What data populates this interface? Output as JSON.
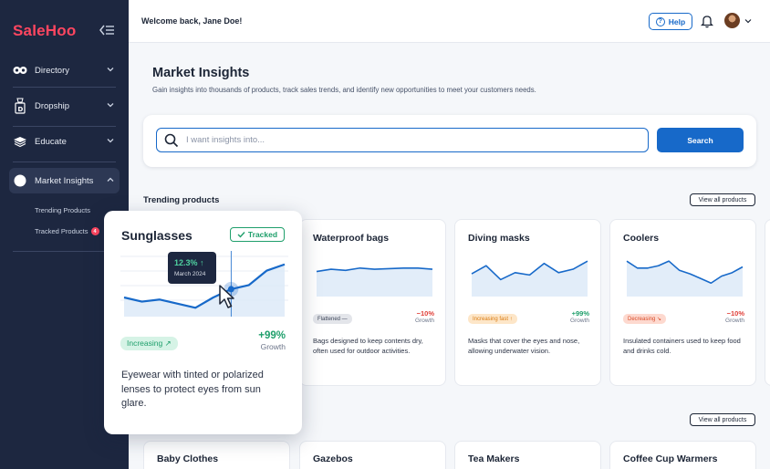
{
  "brand": {
    "logo": "SaleHoo",
    "accent": "#ff4660",
    "primary": "#1769c9"
  },
  "sidebar": {
    "items": [
      {
        "label": "Directory",
        "icon": "directory-icon"
      },
      {
        "label": "Dropship",
        "icon": "dropship-icon"
      },
      {
        "label": "Educate",
        "icon": "educate-icon"
      },
      {
        "label": "Market Insights",
        "icon": "market-insights-icon",
        "active": true
      }
    ],
    "sub_items": [
      {
        "label": "Trending Products"
      },
      {
        "label": "Tracked Products",
        "badge": "4"
      }
    ]
  },
  "header": {
    "welcome": "Welcome back, Jane Doe!",
    "help": "Help"
  },
  "page": {
    "title": "Market Insights",
    "subtitle": "Gain insights into thousands of products, track sales trends, and identify new opportunities to meet your customers needs."
  },
  "search": {
    "placeholder": "I want insights into...",
    "button": "Search"
  },
  "trending": {
    "title": "Trending products",
    "view_all": "View all products",
    "cards": [
      {
        "title": "Waterproof bags",
        "badge": "Flattened —",
        "badge_type": "flat",
        "growth": "−10%",
        "growth_label": "Growth",
        "desc": "Bags designed to keep contents dry, often used for outdoor activities.",
        "spark": [
          62,
          66,
          64,
          68,
          66,
          67,
          68,
          68,
          66
        ]
      },
      {
        "title": "Diving masks",
        "badge": "Increasing fast ↑",
        "badge_type": "inc",
        "growth": "+99%",
        "growth_label": "Growth",
        "desc": "Masks that cover the eyes and nose, allowing underwater vision.",
        "spark": [
          58,
          72,
          48,
          60,
          56,
          76,
          60,
          66,
          80
        ]
      },
      {
        "title": "Coolers",
        "badge": "Decreasing ↘",
        "badge_type": "dec",
        "growth": "−10%",
        "growth_label": "Growth",
        "desc": "Insulated containers used to keep food and drinks cold.",
        "spark": [
          80,
          68,
          68,
          72,
          80,
          64,
          58,
          50,
          42,
          54,
          60,
          70
        ]
      }
    ]
  },
  "second_row": {
    "view_all": "View all products",
    "cards": [
      {
        "title": "Baby Clothes"
      },
      {
        "title": "Gazebos"
      },
      {
        "title": "Tea Makers"
      },
      {
        "title": "Coffee Cup Warmers"
      }
    ]
  },
  "popout": {
    "title": "Sunglasses",
    "tracked": "Tracked",
    "tooltip_value": "12.3% ↑",
    "tooltip_date": "March 2024",
    "badge": "Increasing ↗",
    "growth": "+99%",
    "growth_label": "Growth",
    "desc": "Eyewear with tinted or polarized lenses to protect eyes from sun glare.",
    "spark": [
      40,
      36,
      38,
      34,
      30,
      40,
      48,
      52,
      66,
      72
    ]
  }
}
